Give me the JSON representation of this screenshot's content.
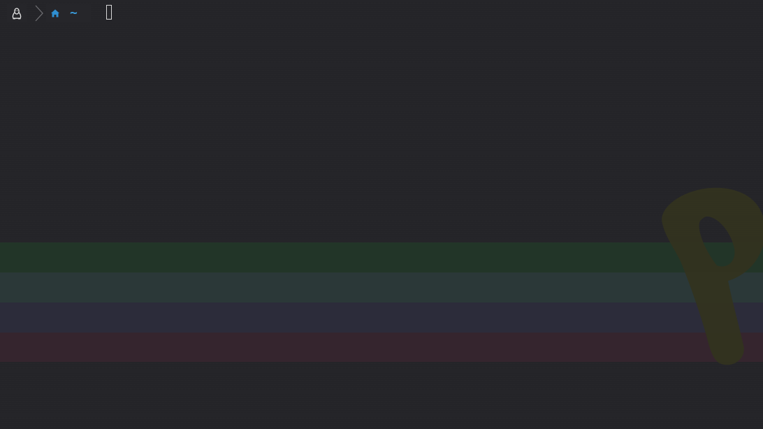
{
  "terminal": {
    "prompt": {
      "os_icon": "linux-penguin-icon",
      "separator_icon": "chevron-right-icon",
      "home_icon": "home-icon",
      "path": "~",
      "path_color": "#3a9ad9"
    },
    "cursor": "block-cursor-icon",
    "background_color": "#242428",
    "watermark_icon": "p-logo-watermark-icon",
    "bands": [
      {
        "name": "green",
        "color": "#223528"
      },
      {
        "name": "teal",
        "color": "#2b3838"
      },
      {
        "name": "slate",
        "color": "#2c2c3a"
      },
      {
        "name": "rose",
        "color": "#35252e"
      }
    ]
  }
}
